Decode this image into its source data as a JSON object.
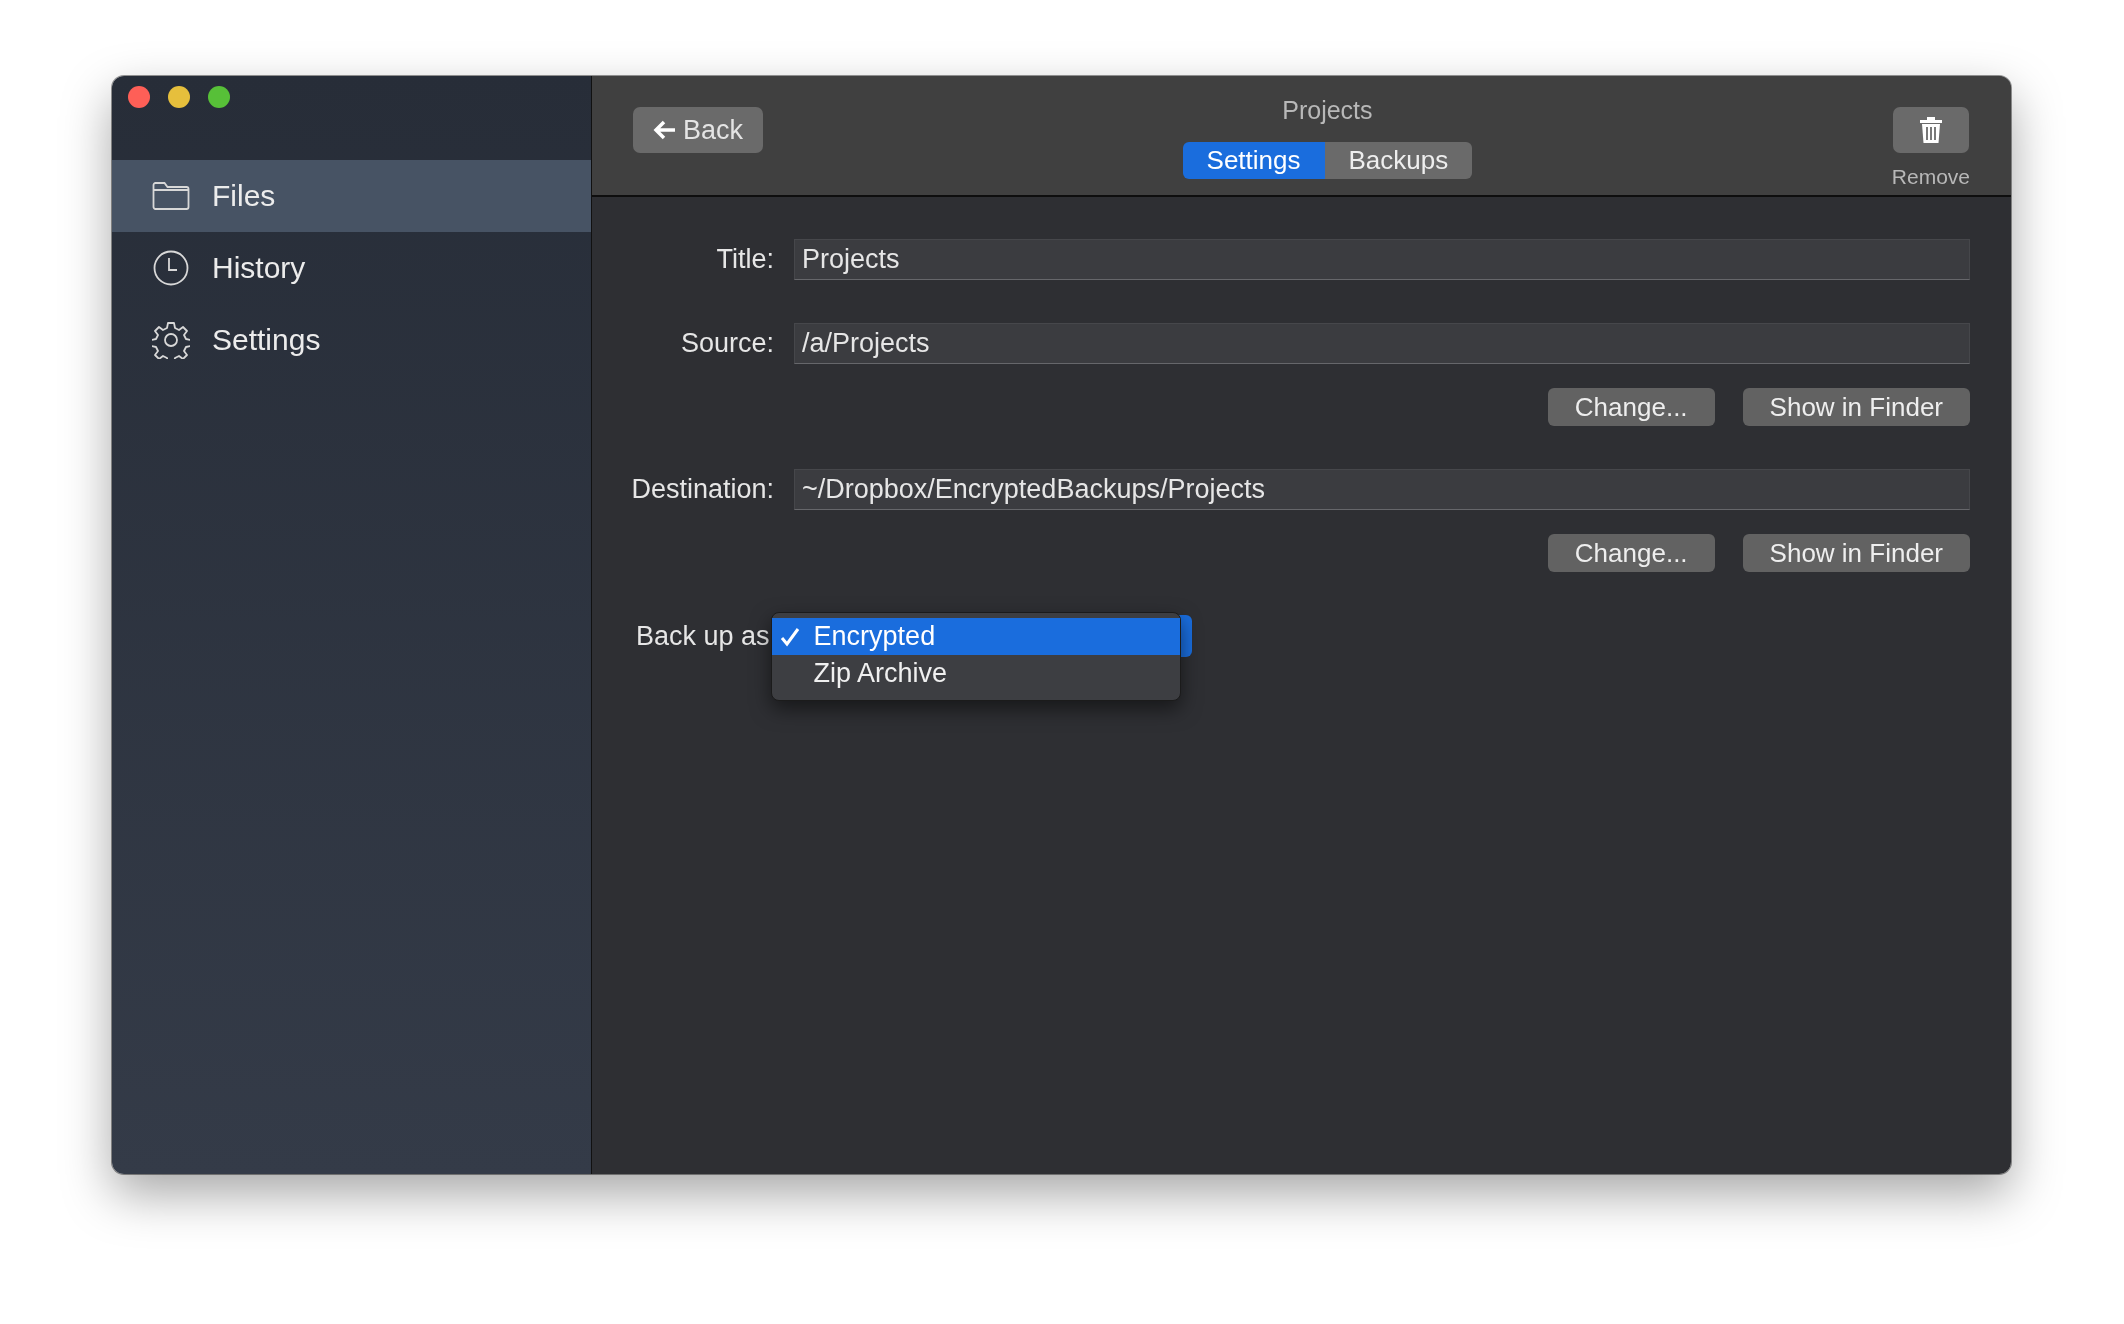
{
  "window": {
    "title": "Projects"
  },
  "sidebar": {
    "items": [
      {
        "label": "Files",
        "selected": true
      },
      {
        "label": "History",
        "selected": false
      },
      {
        "label": "Settings",
        "selected": false
      }
    ]
  },
  "toolbar": {
    "back_button": "Back",
    "tabs": [
      {
        "label": "Settings",
        "selected": true
      },
      {
        "label": "Backups",
        "selected": false
      }
    ],
    "remove_button": "Remove"
  },
  "fields": [
    {
      "label": "Title:",
      "value": "Projects"
    },
    {
      "label": "Source:",
      "value": "/a/Projects",
      "buttons": [
        "Change...",
        "Show in Finder"
      ]
    },
    {
      "label": "Destination:",
      "value": "~/Dropbox/EncryptedBackups/Projects",
      "buttons": [
        "Change...",
        "Show in Finder"
      ]
    }
  ],
  "backup_format": {
    "label": "Back up as",
    "menu": [
      {
        "label": "Encrypted",
        "selected": true
      },
      {
        "label": "Zip Archive",
        "selected": false
      }
    ]
  }
}
